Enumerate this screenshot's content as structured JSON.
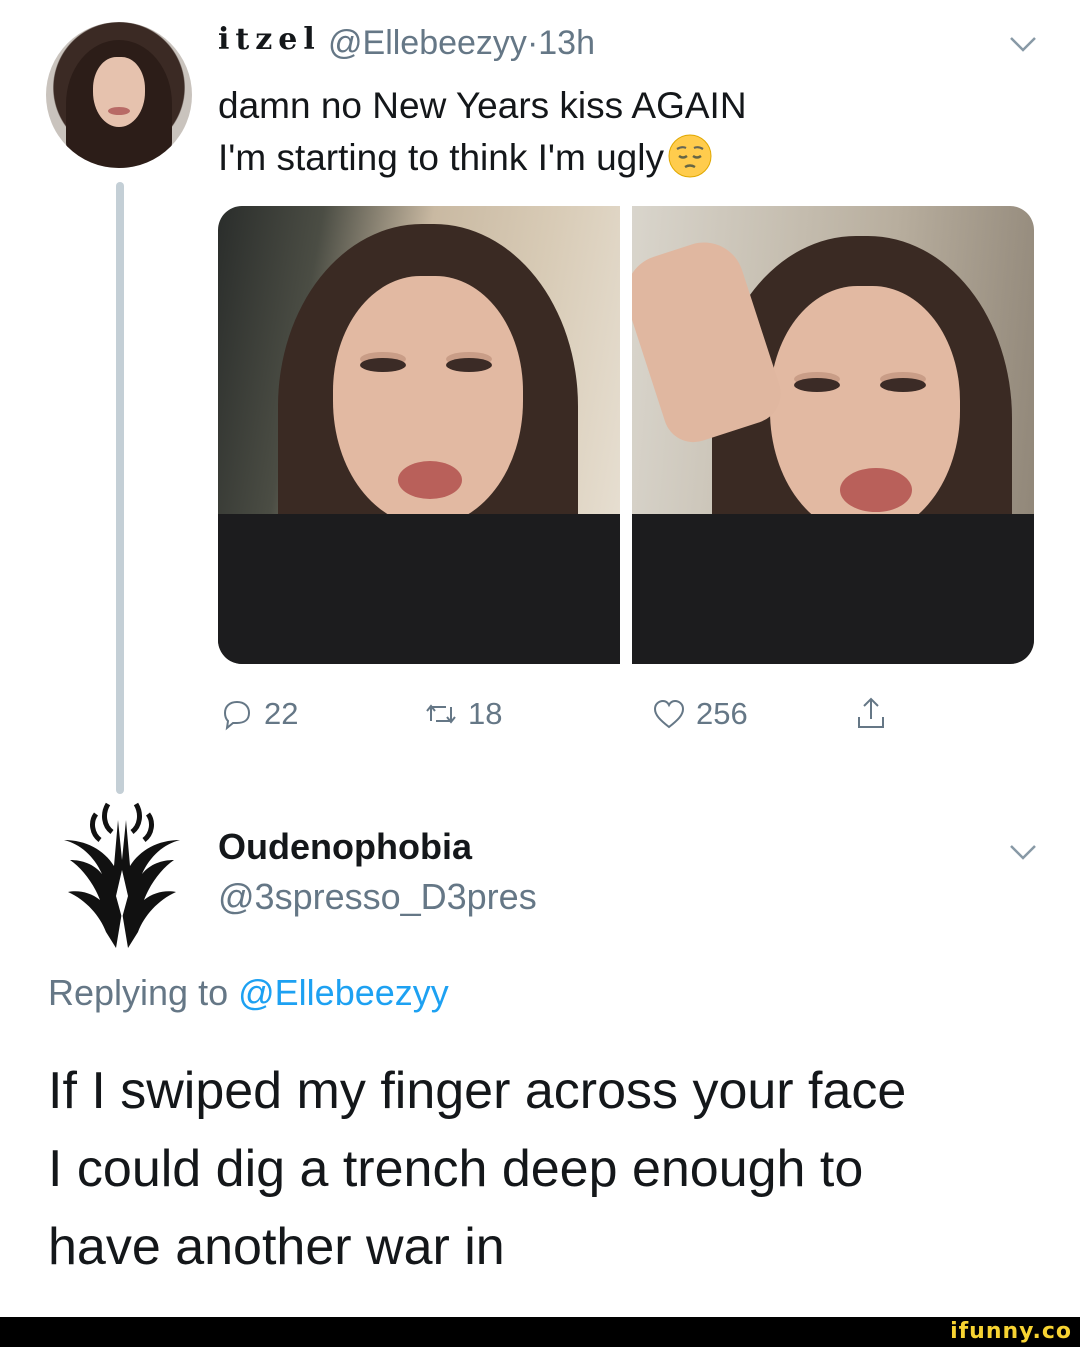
{
  "original_tweet": {
    "display_name": "itzel",
    "handle": "@Ellebeezyy",
    "timestamp": "13h",
    "separator": "·",
    "text_line1": "damn no New Years kiss AGAIN",
    "text_line2": "I'm starting to think I'm ugly",
    "emoji": "pensive-face-emoji",
    "media": [
      "selfie-photo-left",
      "selfie-photo-right"
    ],
    "actions": {
      "reply_count": "22",
      "retweet_count": "18",
      "like_count": "256"
    }
  },
  "reply_tweet": {
    "display_name": "Oudenophobia",
    "handle": "@3spresso_D3pres",
    "replying_prefix": "Replying to",
    "replying_to": "@Ellebeezyy",
    "text_line1": "If I swiped my finger across your face",
    "text_line2": "I could dig a trench deep enough to",
    "text_line3": "have another war in"
  },
  "watermark": "ifunny.co",
  "colors": {
    "text": "#14171a",
    "secondary": "#657786",
    "link": "#1da1f2",
    "thread_line": "#c4cfd6",
    "watermark": "#f7d332"
  },
  "icons": [
    "chevron-down-icon",
    "reply-icon",
    "retweet-icon",
    "heart-icon",
    "share-icon"
  ]
}
